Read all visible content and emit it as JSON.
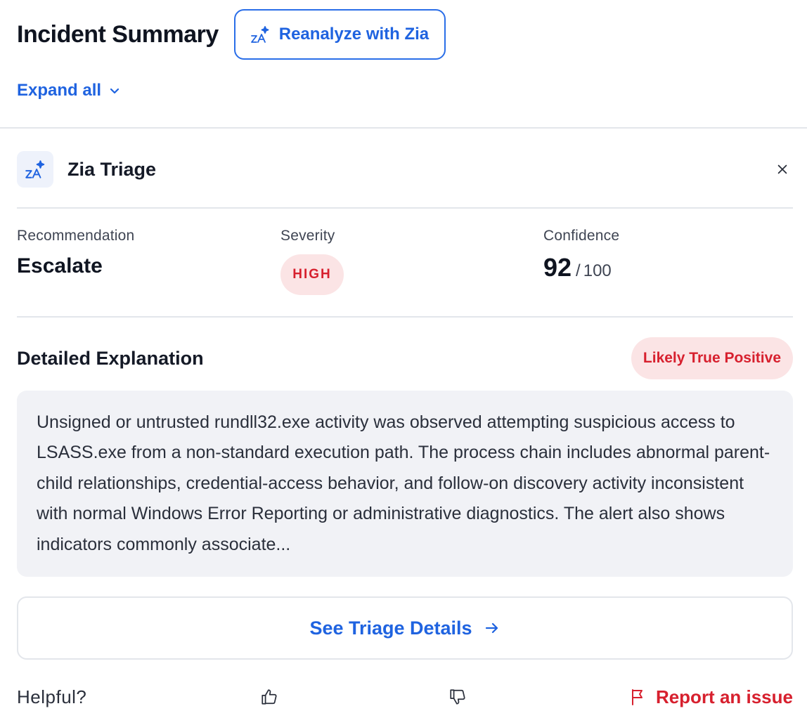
{
  "header": {
    "title": "Incident Summary",
    "reanalyze_label": "Reanalyze with Zia",
    "reanalyze_icon": "zia-sparkle-icon",
    "expand_all_label": "Expand all"
  },
  "triage": {
    "title": "Zia Triage",
    "icon": "zia-sparkle-icon",
    "recommendation_label": "Recommendation",
    "recommendation_value": "Escalate",
    "severity_label": "Severity",
    "severity_value": "HIGH",
    "confidence_label": "Confidence",
    "confidence_value": "92",
    "confidence_separator": "/",
    "confidence_total": "100",
    "explanation_title": "Detailed Explanation",
    "verdict_badge": "Likely True Positive",
    "explanation_text": "Unsigned or untrusted rundll32.exe activity was observed attempting suspicious access to LSASS.exe from a non-standard execution path. The process chain includes abnormal parent-child relationships, credential-access behavior, and follow-on discovery activity inconsistent with normal Windows Error Reporting or administrative diagnostics. The alert also shows indicators commonly associate...",
    "details_button_label": "See Triage Details"
  },
  "feedback": {
    "helpful_label": "Helpful?",
    "report_label": "Report an issue"
  },
  "colors": {
    "accent": "#1f63e0",
    "danger": "#d7202e",
    "danger_bg": "#fbe4e5",
    "panel_bg": "#f1f2f6"
  }
}
